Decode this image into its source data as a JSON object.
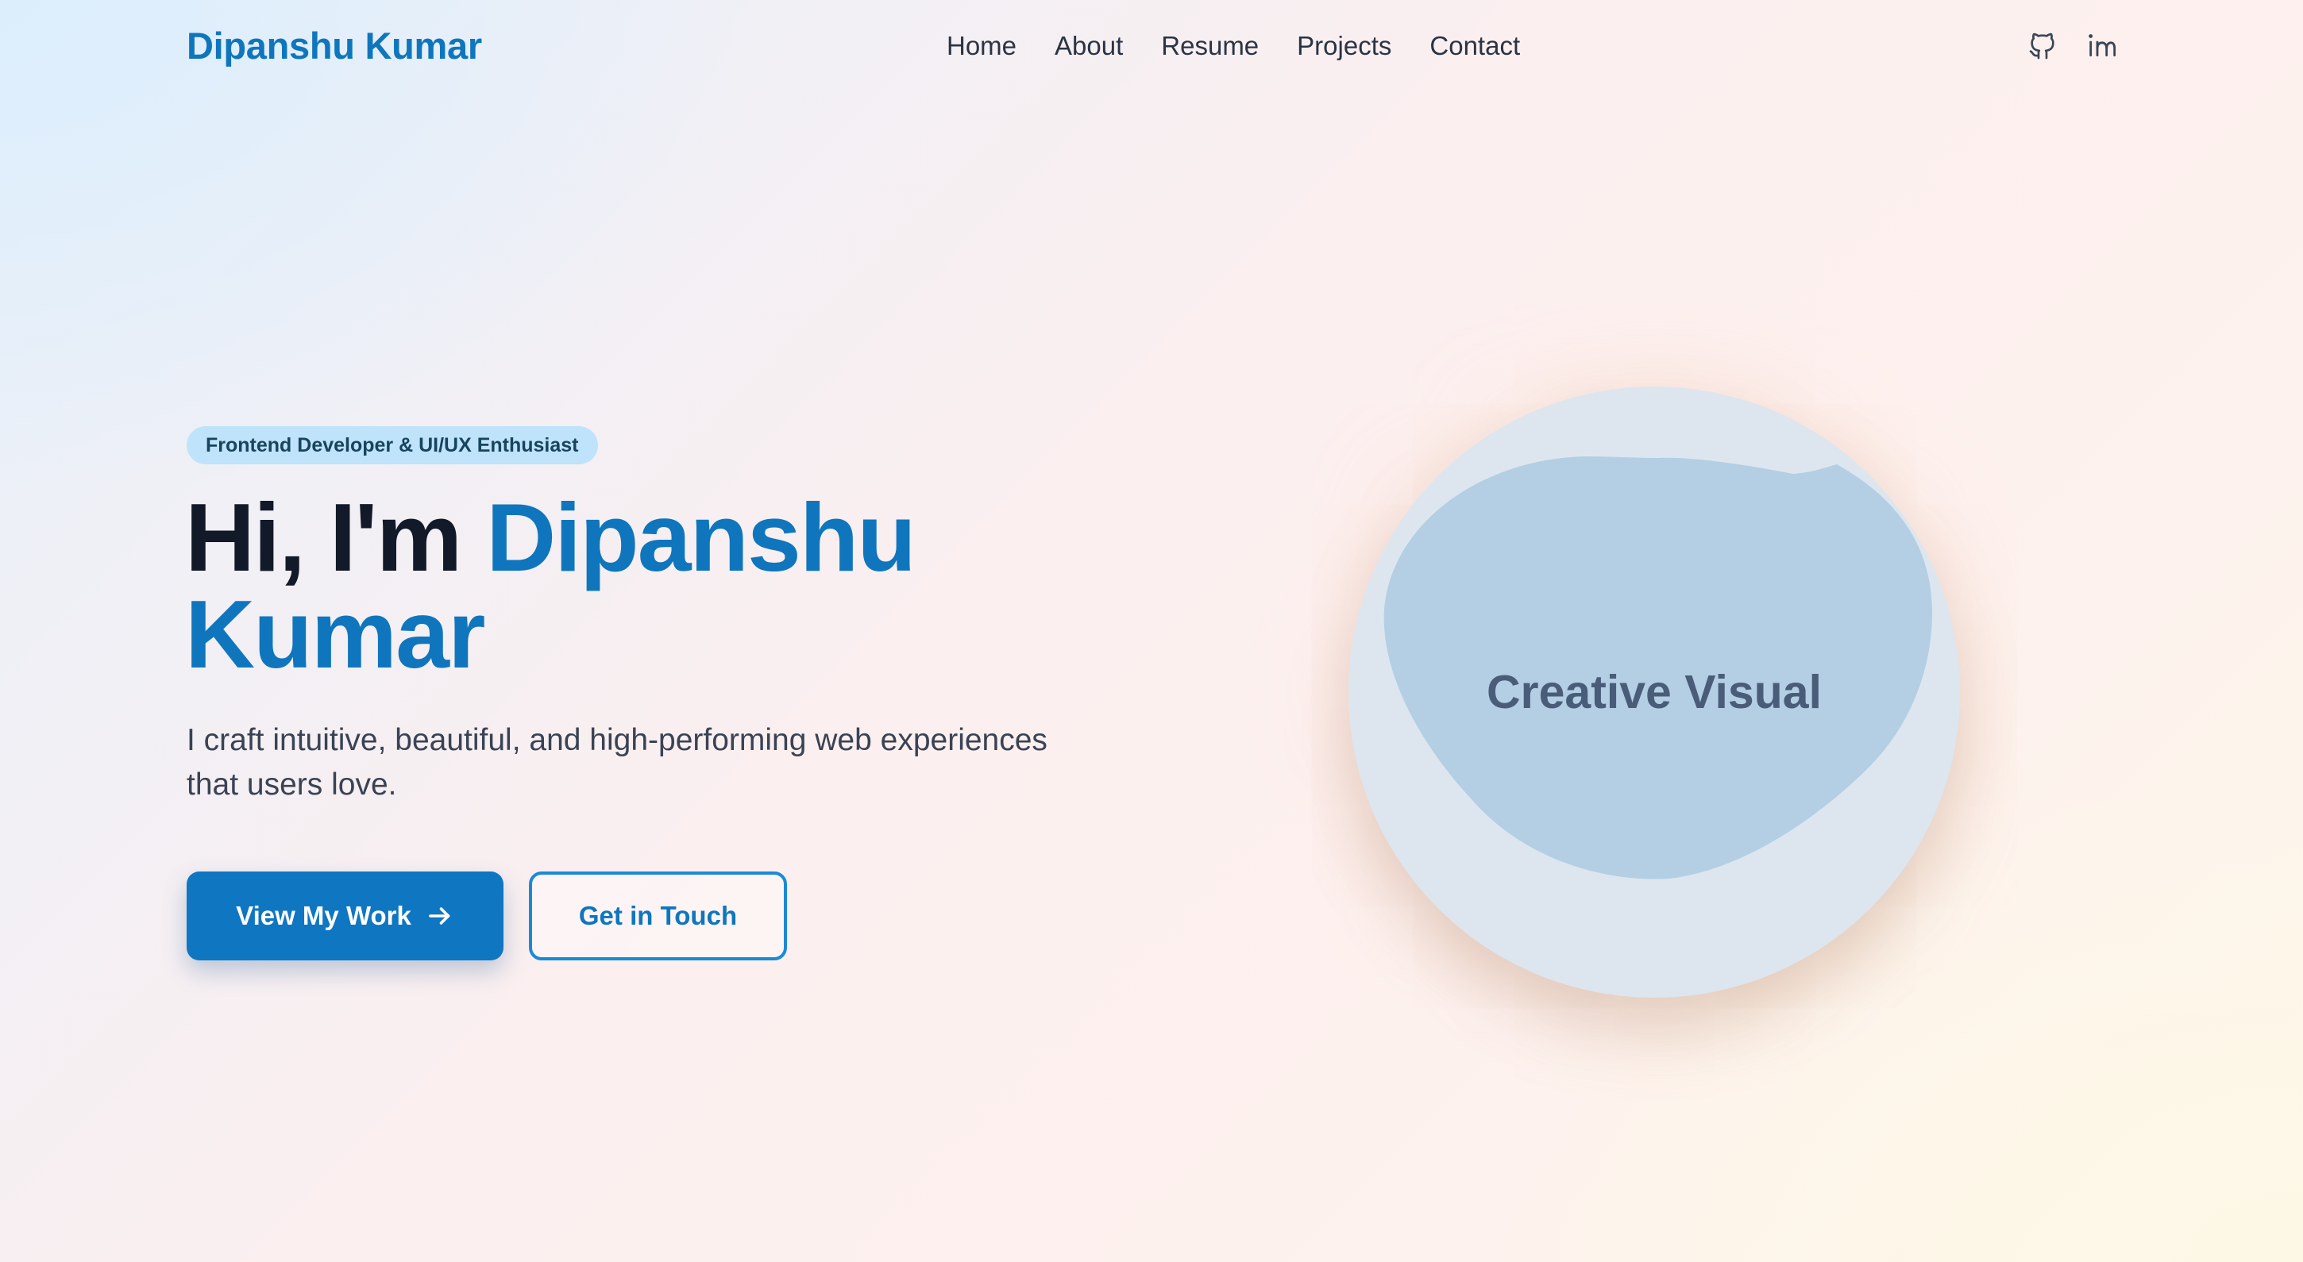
{
  "brand": "Dipanshu Kumar",
  "nav": {
    "links": [
      "Home",
      "About",
      "Resume",
      "Projects",
      "Contact"
    ]
  },
  "socials": [
    {
      "icon": "github-icon"
    },
    {
      "icon": "linkedin-icon"
    }
  ],
  "hero": {
    "badge": "Frontend Developer & UI/UX Enthusiast",
    "title_prefix": "Hi, I'm",
    "title_name_first": "Dipanshu",
    "title_name_last": "Kumar",
    "subtitle": "I craft intuitive, beautiful, and high-performing web experiences that users love.",
    "primary_button": "View My Work",
    "secondary_button": "Get in Touch"
  },
  "visual": {
    "label": "Creative Visual"
  },
  "colors": {
    "accent": "#0f76bd",
    "badge_bg": "#bfe3fa",
    "heading": "#121a29",
    "visual_circle": "#dde6ef",
    "visual_blob": "#b4cfe4"
  }
}
